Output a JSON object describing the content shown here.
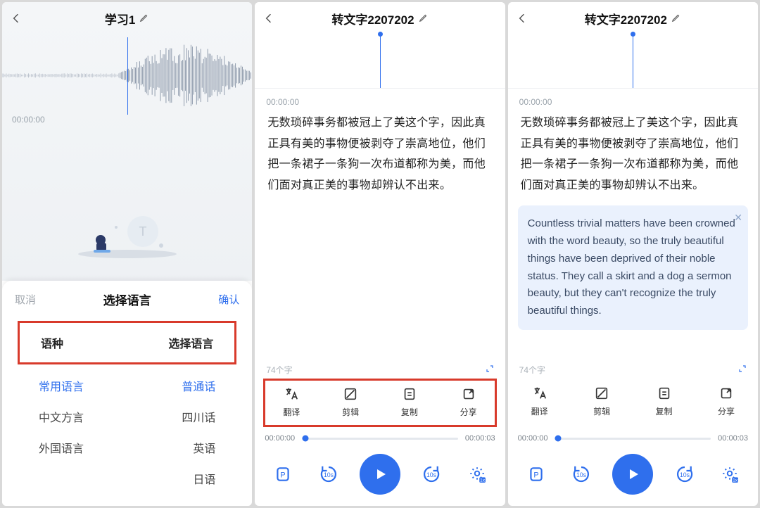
{
  "screen1": {
    "title": "学习1",
    "timecode": "00:00:00",
    "sheet": {
      "cancel": "取消",
      "title": "选择语言",
      "confirm": "确认",
      "header_left": "语种",
      "header_right": "选择语言",
      "rows": [
        {
          "left": "常用语言",
          "right": "普通话",
          "selected": true
        },
        {
          "left": "中文方言",
          "right": "四川话",
          "selected": false
        },
        {
          "left": "外国语言",
          "right": "英语",
          "selected": false
        },
        {
          "left": "",
          "right": "日语",
          "selected": false
        }
      ]
    }
  },
  "screen2": {
    "title": "转文字2207202",
    "timecode": "00:00:00",
    "paragraph": "无数琐碎事务都被冠上了美这个字，因此真正具有美的事物便被剥夺了崇高地位，他们把一条裙子一条狗一次布道都称为美，而他们面对真正美的事物却辨认不出来。",
    "char_count": "74个字",
    "tools": {
      "translate": "翻译",
      "trim": "剪辑",
      "copy": "复制",
      "share": "分享"
    },
    "player": {
      "cur": "00:00:00",
      "dur": "00:00:03"
    }
  },
  "screen3": {
    "title": "转文字2207202",
    "timecode": "00:00:00",
    "paragraph": "无数琐碎事务都被冠上了美这个字，因此真正具有美的事物便被剥夺了崇高地位，他们把一条裙子一条狗一次布道都称为美，而他们面对真正美的事物却辨认不出来。",
    "translation": "Countless trivial matters have been crowned with the word beauty, so the truly beautiful things have been deprived of their noble status. They call a skirt and a dog a sermon beauty, but they can't recognize the truly beautiful things.",
    "char_count": "74个字",
    "tools": {
      "translate": "翻译",
      "trim": "剪辑",
      "copy": "复制",
      "share": "分享"
    },
    "player": {
      "cur": "00:00:00",
      "dur": "00:00:03"
    }
  }
}
